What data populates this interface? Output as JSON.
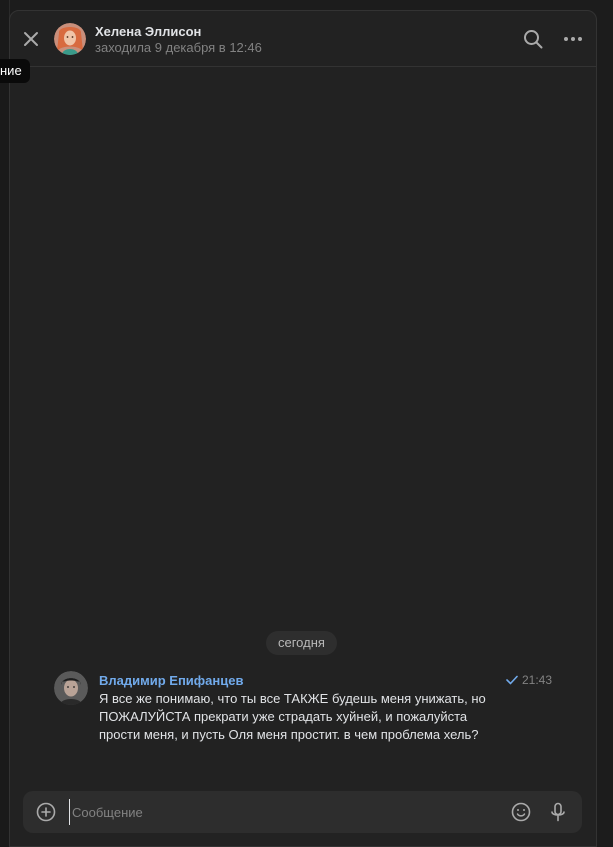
{
  "tooltip": {
    "text": "ние"
  },
  "header": {
    "contact_name": "Хелена Эллисон",
    "status": "заходила 9 декабря в 12:46",
    "icons": {
      "close": "close-icon",
      "search": "search-icon",
      "more": "more-horizontal-icon"
    }
  },
  "date_separator": "сегодня",
  "messages": [
    {
      "author": "Владимир Епифанцев",
      "time": "21:43",
      "read_status_icon": "checkmark-icon",
      "text": "Я все же понимаю, что ты все ТАКЖЕ будешь меня унижать, но ПОЖАЛУЙСТА прекрати уже страдать хуйней, и пожалуйста прости меня, и пусть Оля меня простит. в чем проблема хель?"
    }
  ],
  "composer": {
    "placeholder": "Сообщение",
    "value": "",
    "icons": {
      "attach": "plus-circle-icon",
      "emoji": "emoji-icon",
      "voice": "microphone-icon"
    }
  },
  "colors": {
    "background": "#222222",
    "accent_link": "#71aaeb",
    "text_primary": "#e1e3e6",
    "text_secondary": "#828282"
  }
}
